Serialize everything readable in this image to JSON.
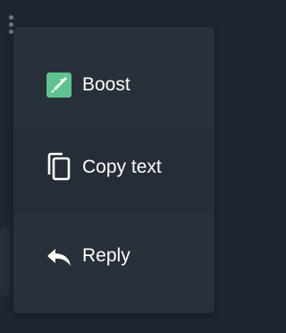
{
  "colors": {
    "background": "#1f2630",
    "menu": "#283039",
    "boost_icon": "#5fc38f",
    "text": "#ffffff"
  },
  "menu": {
    "items": [
      {
        "label": "Boost",
        "icon": "boost-icon"
      },
      {
        "label": "Copy text",
        "icon": "copy-icon"
      },
      {
        "label": "Reply",
        "icon": "reply-icon"
      }
    ]
  }
}
